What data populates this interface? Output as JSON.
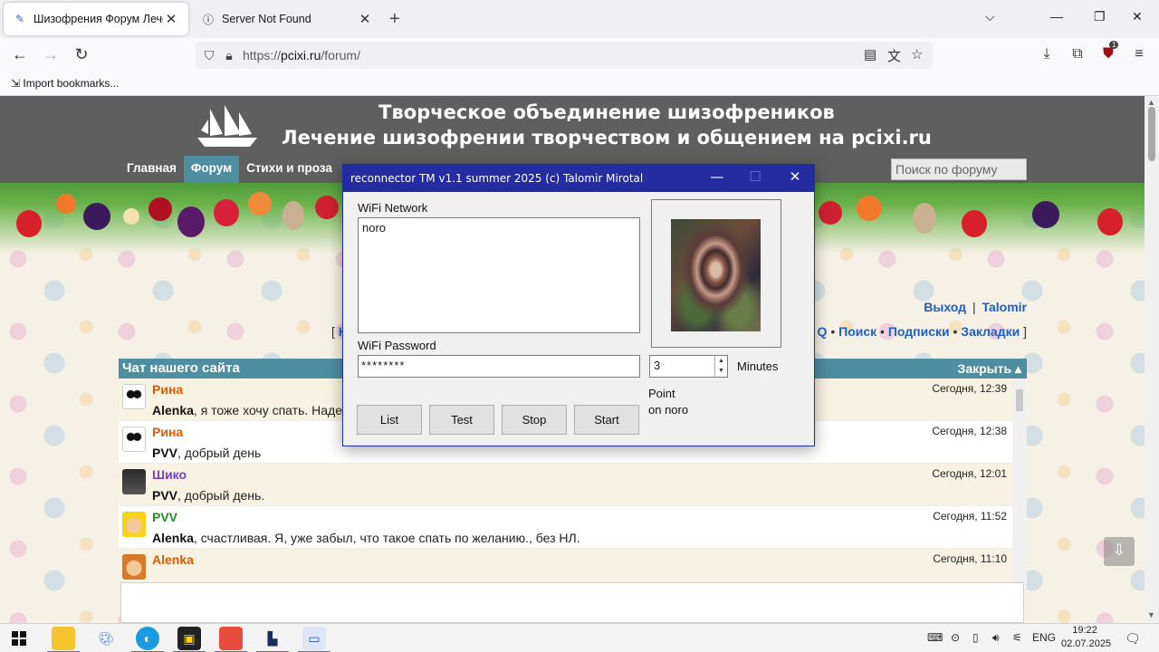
{
  "browser": {
    "tabs": [
      {
        "title": "Шизофрения Форум Лечение",
        "icon": "pen-icon"
      },
      {
        "title": "Server Not Found",
        "icon": "info-icon"
      }
    ],
    "url_prefix": "https://",
    "url_host": "pcixi.ru",
    "url_path": "/forum/",
    "bookmark": "Import bookmarks...",
    "extension_badge": "1"
  },
  "site": {
    "title_line1": "Творческое объединение шизофреников",
    "title_line2": "Лечение шизофрении творчеством и общением на pcixi.ru",
    "menu": [
      "Главная",
      "Форум",
      "Стихи и проза"
    ],
    "search_placeholder": "Поиск по форуму",
    "userlinks": {
      "logout": "Выход",
      "sep": "|",
      "user": "Talomir"
    },
    "toplinks": {
      "open": "[",
      "first": "Н",
      "faq": "Q",
      "search": "Поиск",
      "subs": "Подписки",
      "bookmarks": "Закладки",
      "close": "]",
      "dot": "•"
    }
  },
  "chat": {
    "title": "Чат нашего сайта",
    "close_label": "Закрыть ▴",
    "messages": [
      {
        "author": "Рина",
        "author_color": "#e05a00",
        "time": "Сегодня, 12:39",
        "to": "Alenka",
        "text": ", я тоже хочу спать. Наден"
      },
      {
        "author": "Рина",
        "author_color": "#e05a00",
        "time": "Сегодня, 12:38",
        "to": "PVV",
        "text": ", добрый день"
      },
      {
        "author": "Шико",
        "author_color": "#7a3fbf",
        "time": "Сегодня, 12:01",
        "to": "PVV",
        "text": ", добрый день."
      },
      {
        "author": "PVV",
        "author_color": "#2a8a2a",
        "time": "Сегодня, 11:52",
        "to": "Alenka",
        "text": ", счастливая. Я, уже забыл, что такое спать по желанию., без НЛ."
      },
      {
        "author": "Alenka",
        "author_color": "#e05a00",
        "time": "Сегодня, 11:10",
        "to": "",
        "text": ""
      }
    ]
  },
  "dialog": {
    "title": "reconnector TM  v1.1  summer 2025  (c) Talomir Mirotal",
    "wifi_network_label": "WiFi Network",
    "wifi_network_value": "noro",
    "wifi_password_label": "WiFi Password",
    "wifi_password_value": "********",
    "minutes_value": "3",
    "minutes_label": "Minutes",
    "point_label": "Point",
    "point_value": "on noro",
    "buttons": [
      "List",
      "Test",
      "Stop",
      "Start"
    ]
  },
  "taskbar": {
    "lang": "ENG",
    "time": "19:22",
    "date": "02.07.2025"
  }
}
